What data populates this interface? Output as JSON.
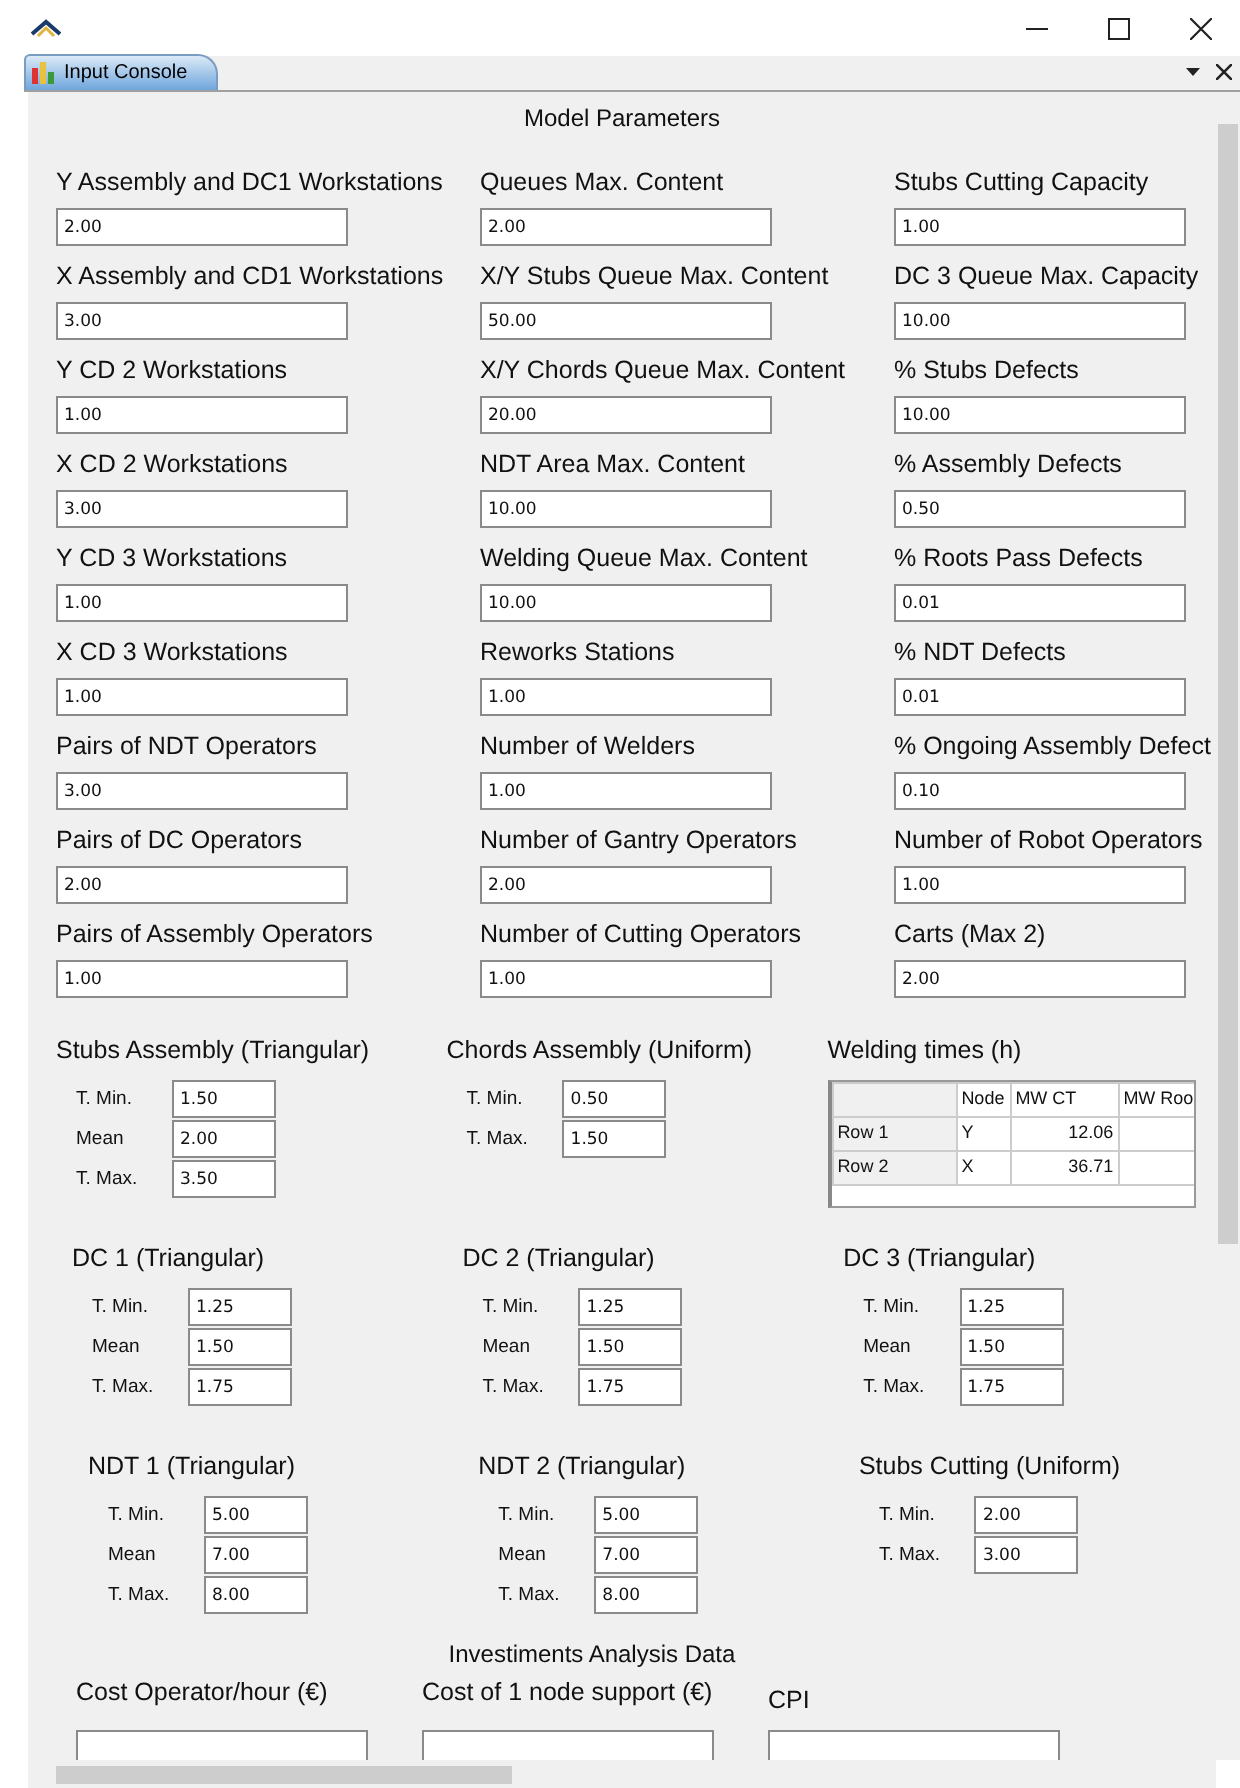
{
  "tabs": [
    {
      "label": "Input Console",
      "selected": true
    }
  ],
  "panel": {
    "title": "Model Parameters",
    "columns": [
      [
        {
          "label": "Y Assembly and DC1 Workstations",
          "value": "2.00"
        },
        {
          "label": "X Assembly and CD1 Workstations",
          "value": "3.00"
        },
        {
          "label": "Y CD 2 Workstations",
          "value": "1.00"
        },
        {
          "label": "X CD 2 Workstations",
          "value": "3.00"
        },
        {
          "label": "Y CD 3 Workstations",
          "value": "1.00"
        },
        {
          "label": "X CD 3 Workstations",
          "value": "1.00"
        },
        {
          "label": "Pairs of NDT Operators",
          "value": "3.00"
        },
        {
          "label": "Pairs of DC Operators",
          "value": "2.00"
        },
        {
          "label": "Pairs of Assembly Operators",
          "value": "1.00"
        }
      ],
      [
        {
          "label": "Queues Max. Content",
          "value": "2.00"
        },
        {
          "label": "X/Y Stubs Queue Max. Content",
          "value": "50.00"
        },
        {
          "label": "X/Y Chords Queue Max. Content",
          "value": "20.00"
        },
        {
          "label": "NDT Area Max. Content",
          "value": "10.00"
        },
        {
          "label": "Welding Queue Max. Content",
          "value": "10.00"
        },
        {
          "label": "Reworks Stations",
          "value": "1.00"
        },
        {
          "label": "Number of Welders",
          "value": "1.00"
        },
        {
          "label": "Number of Gantry Operators",
          "value": "2.00"
        },
        {
          "label": "Number of Cutting Operators",
          "value": "1.00"
        }
      ],
      [
        {
          "label": "Stubs Cutting Capacity",
          "value": "1.00"
        },
        {
          "label": "DC 3 Queue Max. Capacity",
          "value": "10.00"
        },
        {
          "label": "% Stubs Defects",
          "value": "10.00"
        },
        {
          "label": "% Assembly Defects",
          "value": "0.50"
        },
        {
          "label": "% Roots Pass Defects",
          "value": "0.01"
        },
        {
          "label": "% NDT Defects",
          "value": "0.01"
        },
        {
          "label": "% Ongoing Assembly Defect",
          "value": "0.10"
        },
        {
          "label": "Number of Robot Operators",
          "value": "1.00"
        },
        {
          "label": "Carts (Max 2)",
          "value": "2.00"
        }
      ]
    ],
    "sections": [
      [
        {
          "kind": "params",
          "title": "Stubs Assembly (Triangular)",
          "rows": [
            {
              "label": "T. Min.",
              "value": "1.50"
            },
            {
              "label": "Mean",
              "value": "2.00"
            },
            {
              "label": "T. Max.",
              "value": "3.50"
            }
          ]
        },
        {
          "kind": "params",
          "title": "Chords Assembly (Uniform)",
          "rows": [
            {
              "label": "T. Min.",
              "value": "0.50"
            },
            {
              "label": "T. Max.",
              "value": "1.50"
            }
          ]
        },
        {
          "kind": "table",
          "title": "Welding times (h)",
          "columns": [
            "",
            "Node",
            "MW CT",
            "MW Roo"
          ],
          "rows": [
            [
              "Row 1",
              "Y",
              "12.06",
              ""
            ],
            [
              "Row 2",
              "X",
              "36.71",
              ""
            ]
          ]
        }
      ],
      [
        {
          "kind": "params",
          "title": "DC 1 (Triangular)",
          "rows": [
            {
              "label": "T. Min.",
              "value": "1.25"
            },
            {
              "label": "Mean",
              "value": "1.50"
            },
            {
              "label": "T. Max.",
              "value": "1.75"
            }
          ]
        },
        {
          "kind": "params",
          "title": "DC 2 (Triangular)",
          "rows": [
            {
              "label": "T. Min.",
              "value": "1.25"
            },
            {
              "label": "Mean",
              "value": "1.50"
            },
            {
              "label": "T. Max.",
              "value": "1.75"
            }
          ]
        },
        {
          "kind": "params",
          "title": "DC 3 (Triangular)",
          "rows": [
            {
              "label": "T. Min.",
              "value": "1.25"
            },
            {
              "label": "Mean",
              "value": "1.50"
            },
            {
              "label": "T. Max.",
              "value": "1.75"
            }
          ]
        }
      ],
      [
        {
          "kind": "params",
          "title": "NDT 1 (Triangular)",
          "rows": [
            {
              "label": "T. Min.",
              "value": "5.00"
            },
            {
              "label": "Mean",
              "value": "7.00"
            },
            {
              "label": "T. Max.",
              "value": "8.00"
            }
          ]
        },
        {
          "kind": "params",
          "title": "NDT 2 (Triangular)",
          "rows": [
            {
              "label": "T. Min.",
              "value": "5.00"
            },
            {
              "label": "Mean",
              "value": "7.00"
            },
            {
              "label": "T. Max.",
              "value": "8.00"
            }
          ]
        },
        {
          "kind": "params",
          "title": "Stubs Cutting (Uniform)",
          "rows": [
            {
              "label": "T. Min.",
              "value": "2.00"
            },
            {
              "label": "T. Max.",
              "value": "3.00"
            }
          ]
        }
      ]
    ],
    "investments": {
      "title": "Investiments Analysis Data",
      "fields": [
        {
          "label": "Cost Operator/hour (€)"
        },
        {
          "label": "Cost of 1 node support (€)"
        },
        {
          "label": "CPI"
        }
      ]
    }
  }
}
